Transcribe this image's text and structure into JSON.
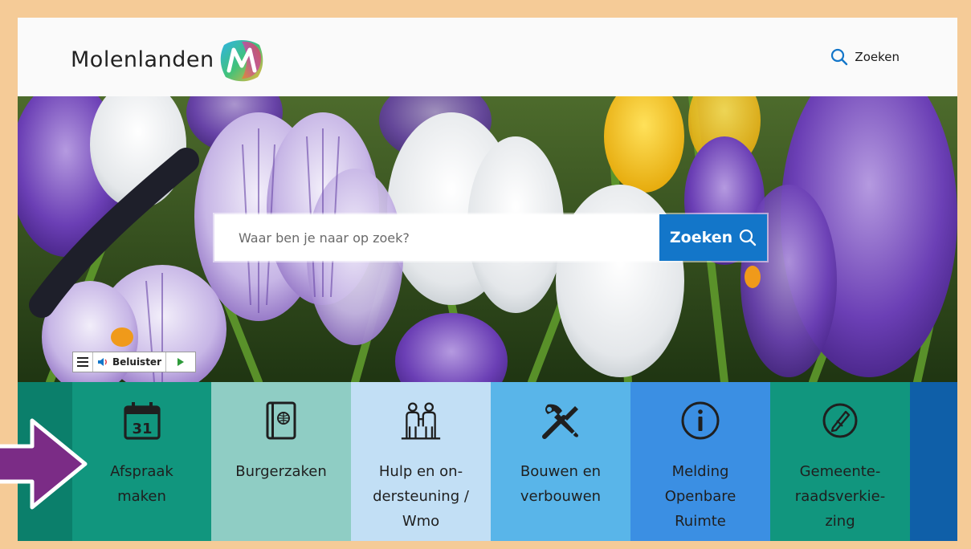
{
  "header": {
    "logo_text": "Molenlanden",
    "search_link_label": "Zoeken"
  },
  "hero": {
    "search_placeholder": "Waar ben je naar op zoek?",
    "search_button_label": "Zoeken",
    "readspeaker": {
      "listen_label": "Beluister"
    }
  },
  "tiles": [
    {
      "label": "Afspraak\nmaken",
      "icon": "calendar-icon",
      "calendar_day": "31",
      "color": "#11967e"
    },
    {
      "label": "Burgerzaken",
      "icon": "passport-icon",
      "color": "#8fcdc4"
    },
    {
      "label": "Hulp en on-\ndersteuning /\nWmo",
      "icon": "people-support-icon",
      "color": "#c2dff5"
    },
    {
      "label": "Bouwen en\nverbouwen",
      "icon": "tools-icon",
      "color": "#59b5e9"
    },
    {
      "label": "Melding\nOpenbare\nRuimte",
      "icon": "info-icon",
      "color": "#3b8fe3"
    },
    {
      "label": "Gemeente-\nraadsverkie-\nzing",
      "icon": "ballot-pen-icon",
      "color": "#11967e"
    }
  ],
  "colors": {
    "accent_blue": "#1376c9",
    "frame_border": "#f5cb97",
    "arrow_purple": "#7b2c86",
    "tile_edge_left": "#0b7f6b",
    "tile_edge_right": "#0f5fa8"
  }
}
